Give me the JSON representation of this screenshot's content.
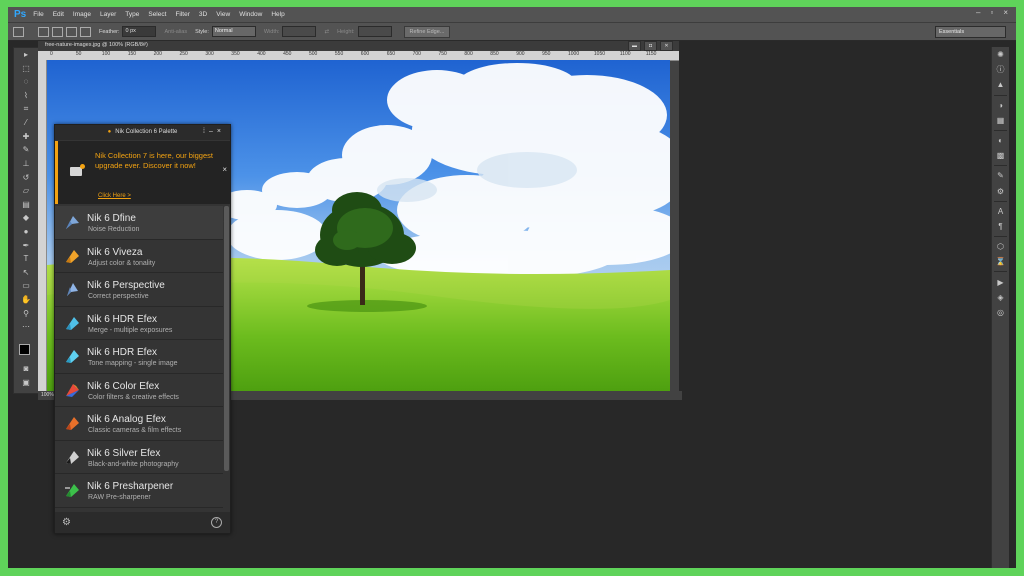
{
  "app": {
    "logo": "Ps",
    "menus": [
      "File",
      "Edit",
      "Image",
      "Layer",
      "Type",
      "Select",
      "Filter",
      "3D",
      "View",
      "Window",
      "Help"
    ],
    "window_controls": [
      "–",
      "▫",
      "×"
    ]
  },
  "options": {
    "feather_label": "Feather:",
    "feather_value": "0 px",
    "antialias_label": "Anti-alias",
    "style_label": "Style:",
    "style_value": "Normal",
    "width_label": "Width:",
    "height_label": "Height:",
    "refine_label": "Refine Edge...",
    "workspace": "Essentials"
  },
  "document": {
    "tab_title": "free-nature-images.jpg @ 100% (RGB/8#)",
    "ruler_ticks": [
      "0",
      "50",
      "100",
      "150",
      "200",
      "250",
      "300",
      "350",
      "400",
      "450",
      "500",
      "550",
      "600",
      "650",
      "700",
      "750",
      "800",
      "850",
      "900",
      "950",
      "1000",
      "1050",
      "1100",
      "1150"
    ],
    "zoom": "100%",
    "controls": [
      "▬",
      "◘",
      "✕"
    ]
  },
  "nik": {
    "title": "Nik Collection 6 Palette",
    "banner_text": "Nik Collection 7 is here, our biggest upgrade ever. Discover it now!",
    "banner_link": "Click Here >",
    "items": [
      {
        "name": "Nik 6 Dfine",
        "desc": "Noise Reduction",
        "color": "#7fa7d9"
      },
      {
        "name": "Nik 6 Viveza",
        "desc": "Adjust color & tonality",
        "color": "#f0a32a"
      },
      {
        "name": "Nik 6 Perspective",
        "desc": "Correct perspective",
        "color": "#8fb4e6"
      },
      {
        "name": "Nik 6 HDR Efex",
        "desc": "Merge - multiple exposures",
        "color": "#4fc0e8"
      },
      {
        "name": "Nik 6 HDR Efex",
        "desc": "Tone mapping - single image",
        "color": "#5fd0f0"
      },
      {
        "name": "Nik 6 Color Efex",
        "desc": "Color filters & creative effects",
        "color": "#e84a3a"
      },
      {
        "name": "Nik 6 Analog Efex",
        "desc": "Classic cameras & film effects",
        "color": "#e8702a"
      },
      {
        "name": "Nik 6 Silver Efex",
        "desc": "Black-and-white photography",
        "color": "#d0d0d0"
      },
      {
        "name": "Nik 6 Presharpener",
        "desc": "RAW Pre-sharpener",
        "color": "#3cc04a"
      }
    ]
  },
  "colors": {
    "frame": "#5fd35a",
    "accent": "#f3a312",
    "panel": "#343434"
  }
}
